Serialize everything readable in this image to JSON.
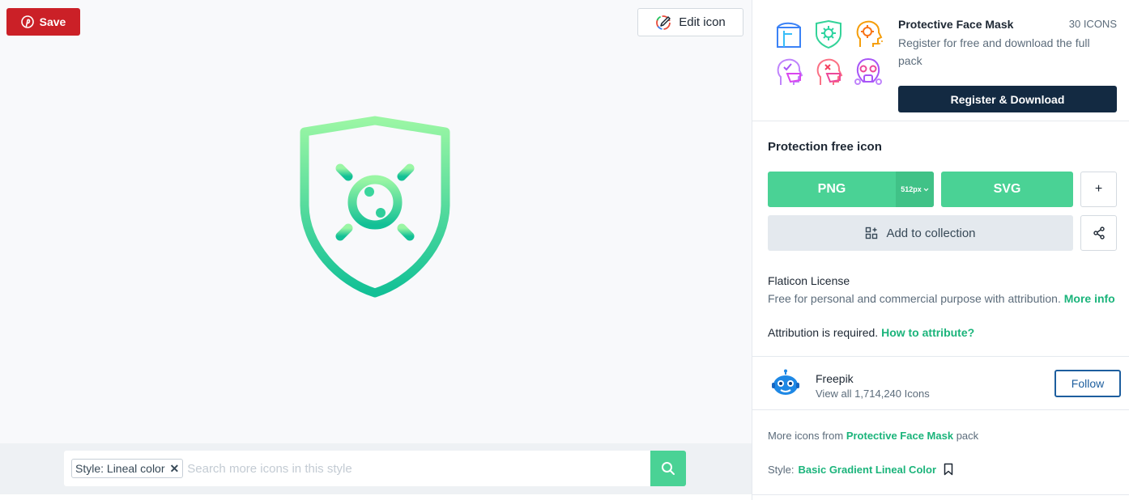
{
  "toolbar": {
    "save_label": "Save",
    "edit_label": "Edit icon"
  },
  "search": {
    "style_tag": "Style: Lineal color",
    "style_tag_remove": "✕",
    "placeholder": "Search more icons in this style"
  },
  "pack": {
    "title": "Protective Face Mask",
    "count": "30 ICONS",
    "description": "Register for free and download the full pack",
    "register_label": "Register & Download",
    "thumbnails": [
      "face-shield-icon",
      "shield-virus-icon",
      "head-virus-icon",
      "mask-check-icon",
      "mask-cross-icon",
      "gas-mask-icon"
    ]
  },
  "download": {
    "title": "Protection free icon",
    "png_label": "PNG",
    "png_size": "512px",
    "svg_label": "SVG",
    "plus_label": "+",
    "collection_label": "Add to collection"
  },
  "license": {
    "title": "Flaticon License",
    "description": "Free for personal and commercial purpose with attribution.",
    "more_info": "More info",
    "attribution": "Attribution is required.",
    "how_to": "How to attribute?"
  },
  "author": {
    "name": "Freepik",
    "link": "View all 1,714,240 Icons",
    "follow_label": "Follow"
  },
  "more": {
    "prefix": "More icons from",
    "pack_name": "Protective Face Mask",
    "suffix": "pack"
  },
  "style": {
    "prefix": "Style:",
    "name": "Basic Gradient Lineal Color"
  },
  "colors": {
    "brand_green": "#4ad295",
    "pinterest_red": "#cb2027",
    "navy": "#132a42",
    "link_green": "#1bb47b",
    "follow_blue": "#1d5e9e"
  }
}
